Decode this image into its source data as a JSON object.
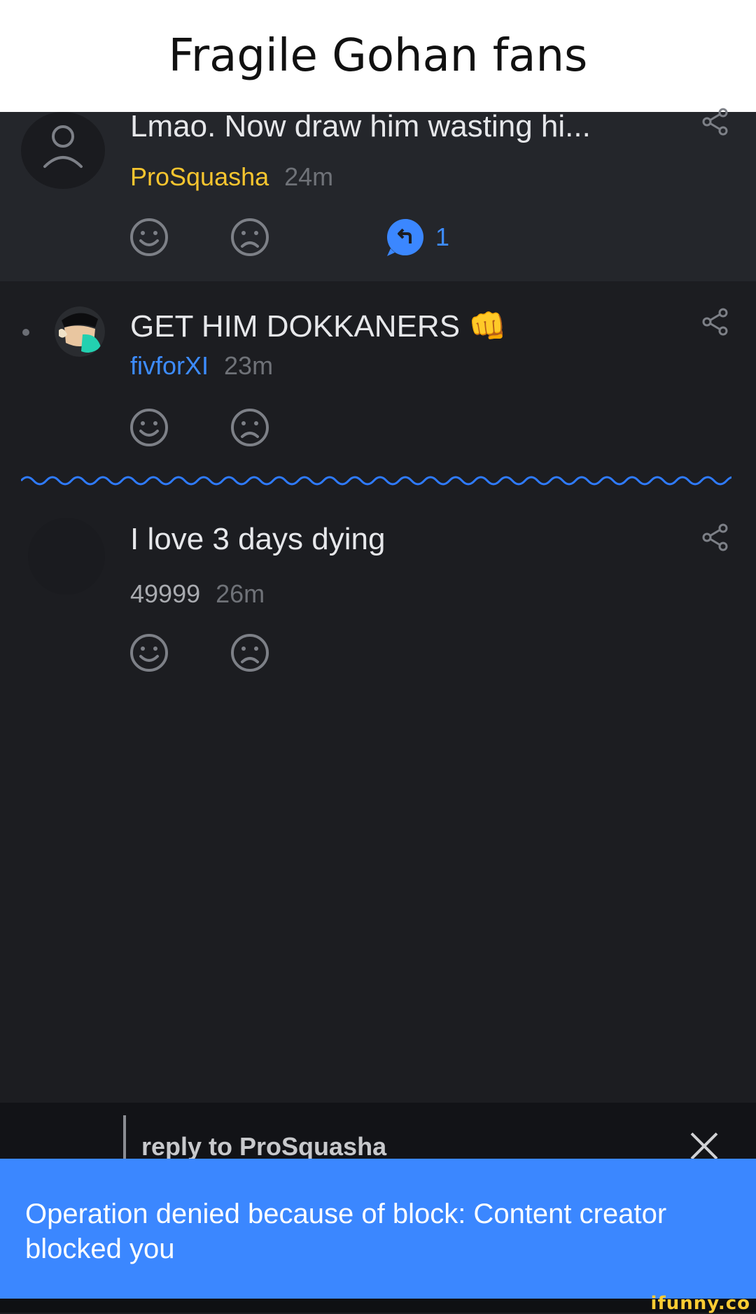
{
  "caption": "Fragile Gohan fans",
  "colors": {
    "username_yellow": "#f7c52f",
    "username_blue": "#3d8cff",
    "toast_bg": "#3b87ff",
    "wavy": "#2f7bff"
  },
  "comments": [
    {
      "text": "Lmao. Now draw him wasting hi...",
      "username": "ProSquasha",
      "time": "24m",
      "avatar": "default-user-icon",
      "reply_count": "1"
    },
    {
      "text": "GET HIM DOKKANERS 👊",
      "username": "fivforXI",
      "time": "23m",
      "avatar": "user-avatar-image"
    },
    {
      "text": "I love 3 days dying",
      "username": "49999",
      "time": "26m",
      "avatar": "dark-avatar"
    }
  ],
  "reply_bar": {
    "label": "reply to ProSquasha"
  },
  "toast": {
    "message": "Operation denied because of block: Content creator blocked you"
  },
  "watermark": "ifunny.co"
}
